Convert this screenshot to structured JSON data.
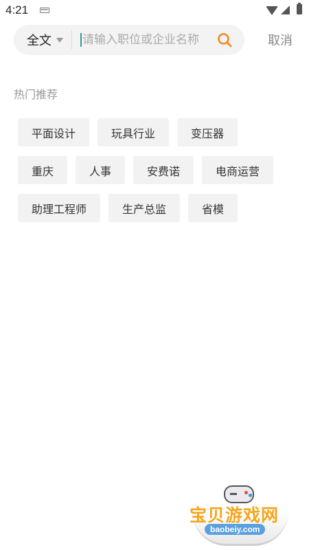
{
  "status_bar": {
    "time": "4:21",
    "icons": [
      "keyboard-icon",
      "wifi-icon",
      "signal-icon",
      "battery-icon"
    ]
  },
  "search": {
    "scope_label": "全文",
    "placeholder": "请输入职位或企业名称",
    "value": "",
    "cancel_label": "取消",
    "accent_color": "#f08a24"
  },
  "hot": {
    "title": "热门推荐",
    "tags": [
      "平面设计",
      "玩具行业",
      "变压器",
      "重庆",
      "人事",
      "安费诺",
      "电商运营",
      "助理工程师",
      "生产总监",
      "省模"
    ]
  },
  "watermark": {
    "title": "宝贝游戏网",
    "url": "baobeiy.com"
  }
}
